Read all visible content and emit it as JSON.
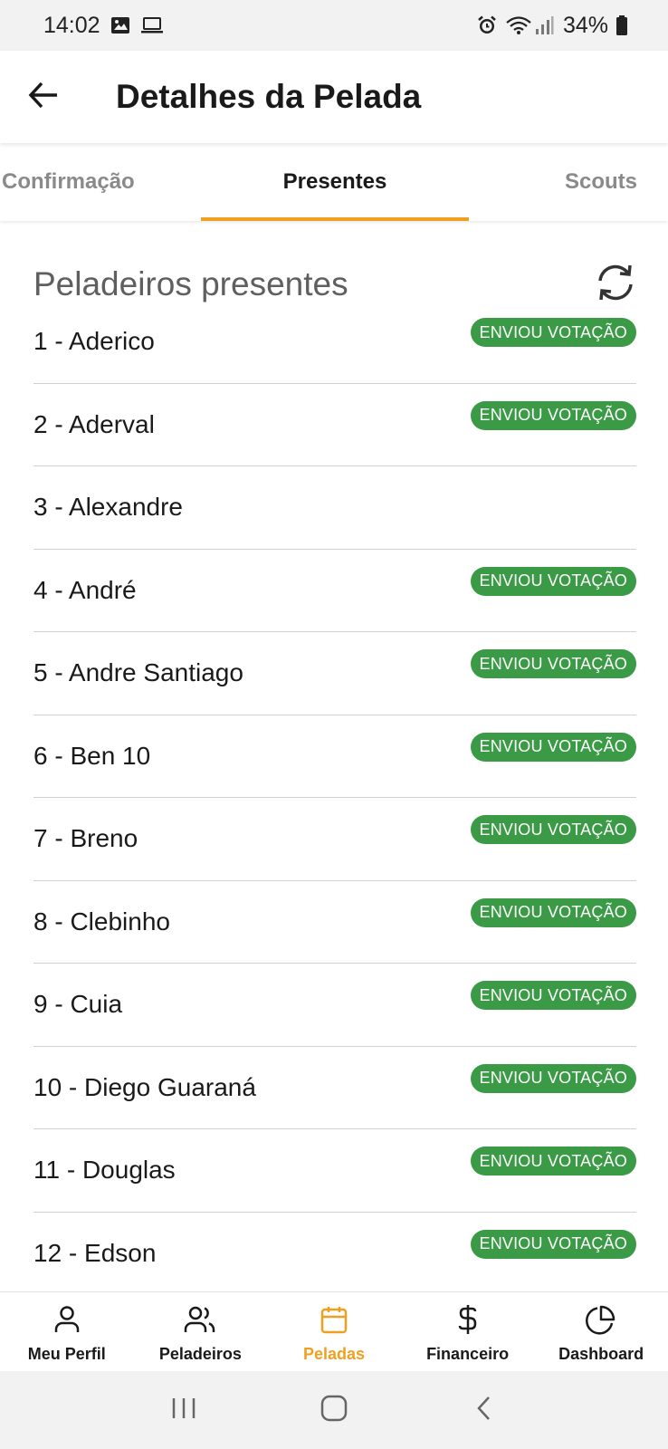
{
  "status_bar": {
    "time": "14:02",
    "battery": "34%",
    "icons_left": [
      "image-icon",
      "laptop-icon"
    ],
    "icons_right": [
      "alarm-icon",
      "wifi-icon",
      "signal-icon",
      "battery-icon"
    ]
  },
  "app_bar": {
    "title": "Detalhes da Pelada",
    "back_icon": "arrow-left-icon"
  },
  "tabs": [
    {
      "label": "Confirmação",
      "active": false
    },
    {
      "label": "Presentes",
      "active": true
    },
    {
      "label": "Scouts",
      "active": false
    }
  ],
  "section": {
    "title": "Peladeiros presentes",
    "refresh_icon": "refresh-icon"
  },
  "players": [
    {
      "name": "1 - Aderico",
      "badge": "ENVIOU VOTAÇÃO"
    },
    {
      "name": "2 - Aderval",
      "badge": "ENVIOU VOTAÇÃO"
    },
    {
      "name": "3 - Alexandre",
      "badge": ""
    },
    {
      "name": "4 - André",
      "badge": "ENVIOU VOTAÇÃO"
    },
    {
      "name": "5 - Andre Santiago",
      "badge": "ENVIOU VOTAÇÃO"
    },
    {
      "name": "6 - Ben 10",
      "badge": "ENVIOU VOTAÇÃO"
    },
    {
      "name": "7 - Breno",
      "badge": "ENVIOU VOTAÇÃO"
    },
    {
      "name": "8 - Clebinho",
      "badge": "ENVIOU VOTAÇÃO"
    },
    {
      "name": "9 - Cuia",
      "badge": "ENVIOU VOTAÇÃO"
    },
    {
      "name": "10 - Diego Guaraná",
      "badge": "ENVIOU VOTAÇÃO"
    },
    {
      "name": "11 - Douglas",
      "badge": "ENVIOU VOTAÇÃO"
    },
    {
      "name": "12 - Edson",
      "badge": "ENVIOU VOTAÇÃO"
    }
  ],
  "bottom_nav": [
    {
      "label": "Meu Perfil",
      "icon": "user-icon",
      "active": false
    },
    {
      "label": "Peladeiros",
      "icon": "users-icon",
      "active": false
    },
    {
      "label": "Peladas",
      "icon": "calendar-icon",
      "active": true
    },
    {
      "label": "Financeiro",
      "icon": "dollar-icon",
      "active": false
    },
    {
      "label": "Dashboard",
      "icon": "pie-chart-icon",
      "active": false
    }
  ],
  "system_nav": [
    "recent-apps-icon",
    "home-icon",
    "back-icon"
  ],
  "colors": {
    "accent": "#f0a020",
    "badge_green": "#3a9a45",
    "status_bar_bg": "#f2f2f2"
  }
}
